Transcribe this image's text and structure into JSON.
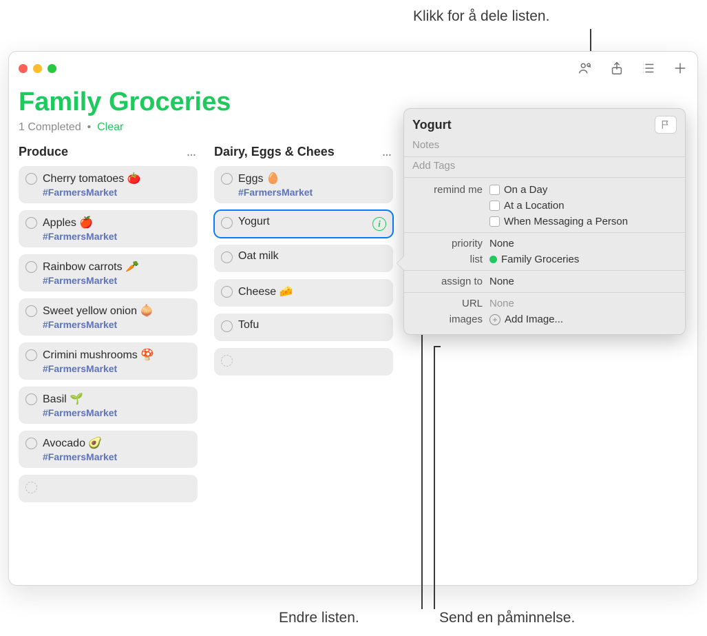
{
  "callouts": {
    "top": "Klikk for å dele listen.",
    "bottom_left": "Endre listen.",
    "bottom_right": "Send en påminnelse."
  },
  "header": {
    "title": "Family Groceries",
    "completed_text": "1 Completed",
    "separator": "•",
    "clear": "Clear"
  },
  "columns": [
    {
      "title": "Produce",
      "more": "…",
      "items": [
        {
          "title": "Cherry tomatoes 🍅",
          "tag": "#FarmersMarket"
        },
        {
          "title": "Apples 🍎",
          "tag": "#FarmersMarket"
        },
        {
          "title": "Rainbow carrots 🥕",
          "tag": "#FarmersMarket"
        },
        {
          "title": "Sweet yellow onion 🧅",
          "tag": "#FarmersMarket"
        },
        {
          "title": "Crimini mushrooms 🍄",
          "tag": "#FarmersMarket"
        },
        {
          "title": "Basil 🌱",
          "tag": "#FarmersMarket"
        },
        {
          "title": "Avocado 🥑",
          "tag": "#FarmersMarket"
        }
      ]
    },
    {
      "title": "Dairy, Eggs & Chees",
      "more": "…",
      "items": [
        {
          "title": "Eggs 🥚",
          "tag": "#FarmersMarket"
        },
        {
          "title": "Yogurt",
          "selected": true
        },
        {
          "title": "Oat milk"
        },
        {
          "title": "Cheese 🧀"
        },
        {
          "title": "Tofu"
        }
      ]
    }
  ],
  "popover": {
    "title": "Yogurt",
    "notes_placeholder": "Notes",
    "tags_placeholder": "Add Tags",
    "remind_label": "remind me",
    "remind_options": [
      "On a Day",
      "At a Location",
      "When Messaging a Person"
    ],
    "priority_label": "priority",
    "priority_value": "None",
    "list_label": "list",
    "list_value": "Family Groceries",
    "assign_label": "assign to",
    "assign_value": "None",
    "url_label": "URL",
    "url_value": "None",
    "images_label": "images",
    "images_value": "Add Image...",
    "info_glyph": "i"
  }
}
